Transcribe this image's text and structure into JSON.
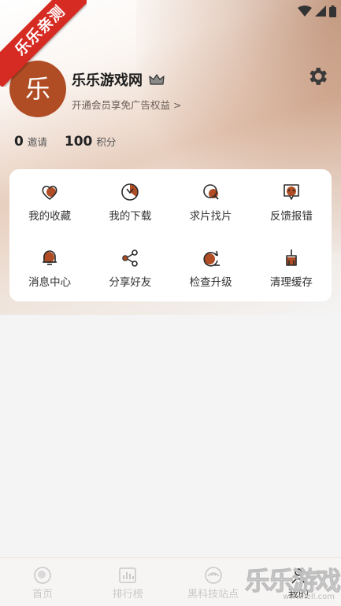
{
  "badge": {
    "text": "乐乐亲测",
    "color": "#d62b22"
  },
  "profile": {
    "avatar_char": "乐",
    "avatar_color": "#b04d24",
    "username": "乐乐游戏网",
    "vip_hint": "开通会员享免广告权益 >"
  },
  "stats": [
    {
      "value": "0",
      "label": "邀请"
    },
    {
      "value": "100",
      "label": "积分"
    }
  ],
  "menu": {
    "items": [
      {
        "label": "我的收藏",
        "icon": "heart-icon"
      },
      {
        "label": "我的下载",
        "icon": "download-icon"
      },
      {
        "label": "求片找片",
        "icon": "search-film-icon"
      },
      {
        "label": "反馈报错",
        "icon": "feedback-icon"
      },
      {
        "label": "消息中心",
        "icon": "bell-icon"
      },
      {
        "label": "分享好友",
        "icon": "share-icon"
      },
      {
        "label": "检查升级",
        "icon": "upgrade-icon"
      },
      {
        "label": "清理缓存",
        "icon": "broom-icon"
      }
    ]
  },
  "tabbar": {
    "items": [
      {
        "label": "首页",
        "icon": "home-icon"
      },
      {
        "label": "排行榜",
        "icon": "ranking-icon"
      },
      {
        "label": "黑科技站点",
        "icon": "tech-site-icon"
      },
      {
        "label": "我的",
        "icon": "mine-icon"
      }
    ]
  },
  "watermark": {
    "title": "乐乐游戏",
    "url": "www.lell.com"
  },
  "colors": {
    "accent": "#b04d24",
    "icon_outline": "#2b2b2b",
    "tab_inactive": "#c9c9c9"
  }
}
